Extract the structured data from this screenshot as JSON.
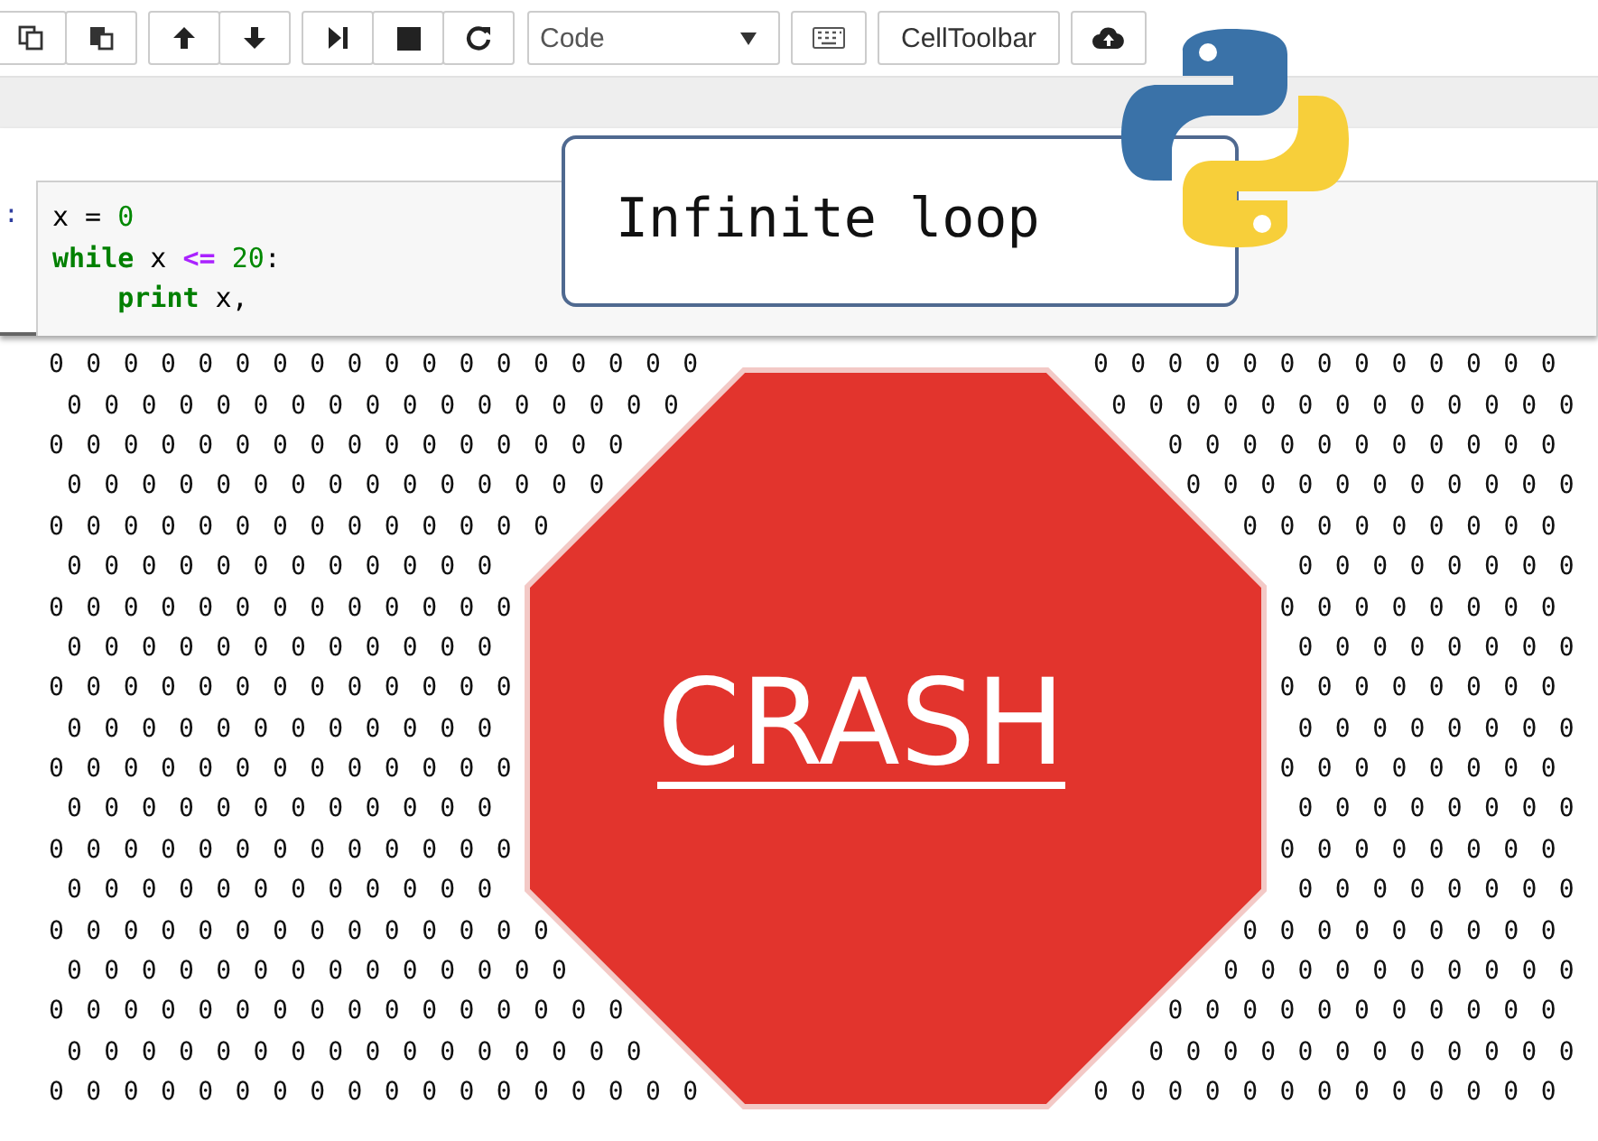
{
  "toolbar": {
    "cell_type": "Code",
    "celltoolbar_label": "CellToolbar"
  },
  "cell": {
    "prompt": ":",
    "lines": [
      [
        {
          "t": "x = ",
          "kind": "plain"
        },
        {
          "t": "0",
          "kind": "number"
        }
      ],
      [
        {
          "t": "while",
          "kind": "keyword"
        },
        {
          "t": " x ",
          "kind": "plain"
        },
        {
          "t": "<=",
          "kind": "operator"
        },
        {
          "t": " 20",
          "kind": "number"
        },
        {
          "t": ":",
          "kind": "plain"
        }
      ],
      [
        {
          "t": "    print",
          "kind": "keyword"
        },
        {
          "t": " x,",
          "kind": "plain"
        }
      ]
    ]
  },
  "callout": {
    "text": "Infinite loop"
  },
  "output": {
    "rows": [
      {
        "left": "0 0 0 0 0 0 0 0 0 0 0 0 0 0 0 0 0 0",
        "right": "0 0 0 0 0 0 0 0 0 0 0 0 0",
        "indented": false
      },
      {
        "left": "0 0 0 0 0 0 0 0 0 0 0 0 0 0 0 0 0",
        "right": "0 0 0 0 0 0 0 0 0 0 0 0 0",
        "indented": true
      },
      {
        "left": "0 0 0 0 0 0 0 0 0 0 0 0 0 0 0 0",
        "right": "0 0 0 0 0 0 0 0 0 0 0",
        "indented": false
      },
      {
        "left": "0 0 0 0 0 0 0 0 0 0 0 0 0 0 0",
        "right": "0 0 0 0 0 0 0 0 0 0 0",
        "indented": true
      },
      {
        "left": "0 0 0 0 0 0 0 0 0 0 0 0 0 0",
        "right": "0 0 0 0 0 0 0 0 0",
        "indented": false
      },
      {
        "left": "0 0 0 0 0 0 0 0 0 0 0 0",
        "right": "0 0 0 0 0 0 0 0",
        "indented": true
      },
      {
        "left": "0 0 0 0 0 0 0 0 0 0 0 0 0",
        "right": "0 0 0 0 0 0 0 0",
        "indented": false
      },
      {
        "left": "0 0 0 0 0 0 0 0 0 0 0 0",
        "right": "0 0 0 0 0 0 0 0",
        "indented": true
      },
      {
        "left": "0 0 0 0 0 0 0 0 0 0 0 0 0",
        "right": "0 0 0 0 0 0 0 0",
        "indented": false
      },
      {
        "left": "0 0 0 0 0 0 0 0 0 0 0 0",
        "right": "0 0 0 0 0 0 0 0",
        "indented": true
      },
      {
        "left": "0 0 0 0 0 0 0 0 0 0 0 0 0",
        "right": "0 0 0 0 0 0 0 0",
        "indented": false
      },
      {
        "left": "0 0 0 0 0 0 0 0 0 0 0 0",
        "right": "0 0 0 0 0 0 0 0",
        "indented": true
      },
      {
        "left": "0 0 0 0 0 0 0 0 0 0 0 0 0",
        "right": "0 0 0 0 0 0 0 0",
        "indented": false
      },
      {
        "left": "0 0 0 0 0 0 0 0 0 0 0 0",
        "right": "0 0 0 0 0 0 0 0",
        "indented": true
      },
      {
        "left": "0 0 0 0 0 0 0 0 0 0 0 0 0 0",
        "right": "0 0 0 0 0 0 0 0 0",
        "indented": false
      },
      {
        "left": "0 0 0 0 0 0 0 0 0 0 0 0 0 0",
        "right": "0 0 0 0 0 0 0 0 0 0",
        "indented": true
      },
      {
        "left": "0 0 0 0 0 0 0 0 0 0 0 0 0 0 0 0",
        "right": "0 0 0 0 0 0 0 0 0 0 0",
        "indented": false
      },
      {
        "left": "0 0 0 0 0 0 0 0 0 0 0 0 0 0 0 0",
        "right": "0 0 0 0 0 0 0 0 0 0 0 0",
        "indented": true
      },
      {
        "left": "0 0 0 0 0 0 0 0 0 0 0 0 0 0 0 0 0 0",
        "right": "0 0 0 0 0 0 0 0 0 0 0 0 0",
        "indented": false
      }
    ]
  },
  "sign": {
    "text": "CRASH"
  }
}
